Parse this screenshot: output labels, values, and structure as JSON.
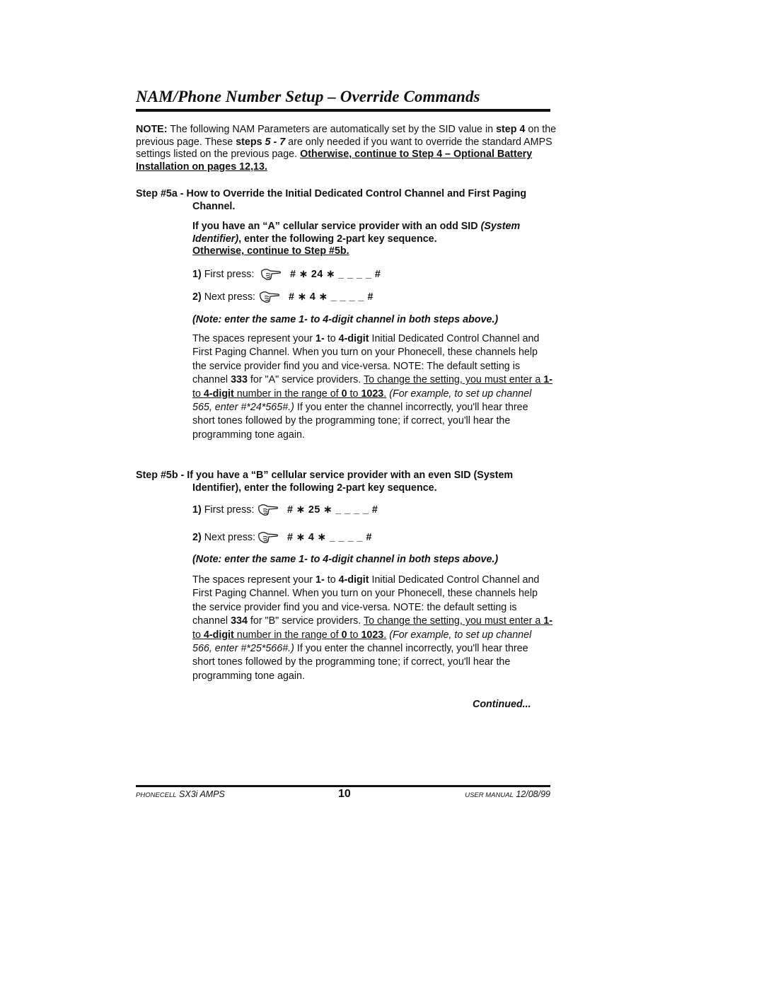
{
  "page": {
    "title": "NAM/Phone Number Setup – Override Commands",
    "note": {
      "label": "NOTE:",
      "t1": " The following NAM Parameters are automatically set by the SID value in ",
      "b1": "step 4",
      "t2": " on the previous page. These ",
      "b2": "steps ",
      "b2i": "5 - 7",
      "t3": " are only needed if you want to override the standard AMPS settings listed on the previous page. ",
      "link": "Otherwise, continue to Step 4 – Optional Battery Installation on pages 12,13."
    },
    "step5a": {
      "heading": "Step #5a - How to Override the Initial Dedicated Control Channel and First Paging Channel.",
      "intro_b1": "If you have an “A” cellular service provider with an odd SID ",
      "intro_i": "(System Identifier)",
      "intro_b2": ", enter the following 2-part key sequence.",
      "intro_link": "Otherwise, continue to Step #5b.",
      "presses": [
        {
          "num": "1)",
          "label": " First press:",
          "icon": "pointing-hand-icon",
          "sequence": "# ∗ 24 ∗ _ _ _ _ #"
        },
        {
          "num": "2)",
          "label": " Next press:",
          "icon": "pointing-hand-icon",
          "sequence": "# ∗ 4 ∗ _ _ _ _ #"
        }
      ],
      "same_note": "(Note: enter the same 1- to 4-digit channel in both steps above.)",
      "desc": {
        "p1": "The spaces represent your ",
        "b1": "1-",
        "p2": " to ",
        "b2": "4-digit",
        "p3": " Initial Dedicated Control Channel and First Paging Channel. When you turn on your Phonecell, these channels help the service provider find you and vice-versa. NOTE: The default setting is channel ",
        "b3": "333",
        "p4": " for \"A\" service providers. ",
        "u1": "To change the setting, you must enter a ",
        "ub1": "1-",
        "u2": " to ",
        "ub2": "4-digit",
        "u3": " number in the range of ",
        "ub3": "0",
        "u4": " to ",
        "ub4": "1023",
        "u5": ".",
        "i1": " (For example, to set up channel 565, enter #*24*565#.)",
        "p5": " If you enter the channel incorrectly, you'll hear three short tones followed by the programming tone; if correct, you'll hear the programming tone again."
      }
    },
    "step5b": {
      "heading": "Step #5b - If you have a “B” cellular service provider with an even SID (System Identifier), enter the following 2-part key sequence.",
      "presses": [
        {
          "num": "1)",
          "label": " First press:",
          "icon": "pointing-hand-icon",
          "sequence": "# ∗ 25 ∗ _ _ _ _ #"
        },
        {
          "num": "2)",
          "label": " Next press:",
          "icon": "pointing-hand-icon",
          "sequence": "# ∗ 4 ∗ _ _ _ _ #"
        }
      ],
      "same_note": "(Note: enter the same 1- to 4-digit channel in both steps above.)",
      "desc": {
        "p1": "The spaces represent your ",
        "b1": "1-",
        "p2": " to ",
        "b2": "4-digit",
        "p3": " Initial Dedicated Control Channel and First Paging Channel. When you turn on your Phonecell, these channels help the service provider find you and vice-versa. NOTE: the default setting is channel ",
        "b3": "334",
        "p4": " for \"B\" service providers. ",
        "u1": "To change the setting, you must enter a ",
        "ub1": "1-",
        "u2": " to ",
        "ub2": "4-digit",
        "u3": " number in the range of ",
        "ub3": "0",
        "u4": " to ",
        "ub4": "1023",
        "u5": ".",
        "i1": " (For example, to set up channel 566, enter #*25*566#.)",
        "p5": " If you enter the channel incorrectly, you'll hear three short tones followed by the programming tone; if correct, you'll hear the programming tone again."
      },
      "continued": "Continued..."
    },
    "footer": {
      "left_sc": "Phonecell",
      "left": " SX3i AMPS",
      "page_number": "10",
      "right_sc": "User Manual",
      "right": " 12/08/99"
    }
  }
}
